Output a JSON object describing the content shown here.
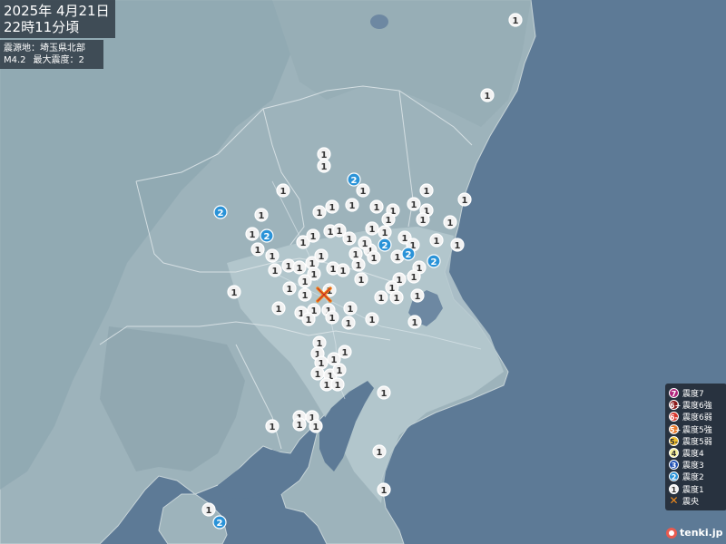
{
  "header": {
    "date": "2025年  4月21日",
    "time": "22時11分頃"
  },
  "quake_info": {
    "epicenter": "震源地：埼玉県北部",
    "magnitude": "M4.2",
    "max_intensity": "最大震度：2"
  },
  "legend": [
    {
      "label": "震度7",
      "badge": "7",
      "color": "#b0227a",
      "text_color": "#ffffff"
    },
    {
      "label": "震度6強",
      "badge": "6+",
      "color": "#8a1818",
      "text_color": "#ffffff"
    },
    {
      "label": "震度6弱",
      "badge": "6-",
      "color": "#d9342b",
      "text_color": "#ffffff"
    },
    {
      "label": "震度5強",
      "badge": "5+",
      "color": "#e8792a",
      "text_color": "#ffffff"
    },
    {
      "label": "震度5弱",
      "badge": "5-",
      "color": "#f2c12e",
      "text_color": "#333333"
    },
    {
      "label": "震度4",
      "badge": "4",
      "color": "#f4ee9a",
      "text_color": "#333333"
    },
    {
      "label": "震度3",
      "badge": "3",
      "color": "#1f4fb3",
      "text_color": "#ffffff"
    },
    {
      "label": "震度2",
      "badge": "2",
      "color": "#2a93d8",
      "text_color": "#ffffff"
    },
    {
      "label": "震度1",
      "badge": "1",
      "color": "#f2f2f2",
      "text_color": "#333333"
    },
    {
      "label": "震央",
      "badge": "✕",
      "color": "transparent",
      "text_color": "#f08a1c"
    }
  ],
  "station_levels": [
    "1",
    "1",
    "1",
    "1",
    "2",
    "1",
    "2",
    "1",
    "1",
    "1",
    "1",
    "1",
    "1",
    "1",
    "1",
    "1",
    "1",
    "1",
    "1",
    "1",
    "1",
    "2",
    "1",
    "1",
    "1",
    "1",
    "1",
    "1",
    "1",
    "1",
    "1",
    "2",
    "1",
    "1",
    "1",
    "1",
    "1",
    "1",
    "2",
    "2",
    "1",
    "1",
    "1",
    "1",
    "1",
    "1",
    "1",
    "1",
    "1",
    "1",
    "1",
    "1",
    "1",
    "1",
    "1",
    "1",
    "1",
    "1",
    "1",
    "1",
    "1",
    "1",
    "1",
    "1",
    "1",
    "1",
    "1",
    "1",
    "1",
    "1",
    "1",
    "1",
    "1",
    "1",
    "1",
    "1",
    "1",
    "1",
    "1",
    "1",
    "1",
    "1",
    "1",
    "1",
    "1",
    "1",
    "1",
    "1",
    "1",
    "1",
    "2",
    "1",
    "1",
    "1",
    "1",
    "1"
  ],
  "logo": "tenki.jp"
}
